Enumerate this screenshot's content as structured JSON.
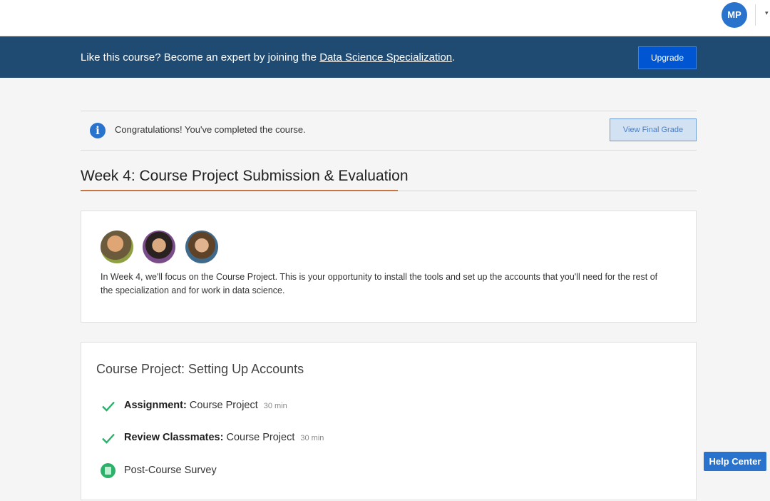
{
  "header": {
    "avatar_initials": "MP"
  },
  "banner": {
    "text_prefix": "Like this course? Become an expert by joining the ",
    "link_text": "Data Science Specialization",
    "text_suffix": ".",
    "upgrade_label": "Upgrade"
  },
  "congrats": {
    "icon": "info-icon",
    "message": "Congratulations! You've completed the course.",
    "button_label": "View Final Grade"
  },
  "week": {
    "title": "Week 4: Course Project Submission & Evaluation",
    "intro": "In Week 4, we'll focus on the Course Project. This is your opportunity to install the tools and set up the accounts that you'll need for the rest of the specialization and for work in data science."
  },
  "project": {
    "title": "Course Project: Setting Up Accounts",
    "items": [
      {
        "type": "Assignment:",
        "name": "Course Project",
        "duration": "30 min",
        "status": "completed"
      },
      {
        "type": "Review Classmates:",
        "name": "Course Project",
        "duration": "30 min",
        "status": "completed"
      },
      {
        "type": "",
        "name": "Post-Course Survey",
        "duration": "",
        "status": "survey"
      }
    ]
  },
  "help": {
    "label": "Help Center"
  },
  "colors": {
    "banner_bg": "#1f4a72",
    "accent_blue": "#2a73cc",
    "check_green": "#2cb16a",
    "title_underline": "#c9733f"
  }
}
